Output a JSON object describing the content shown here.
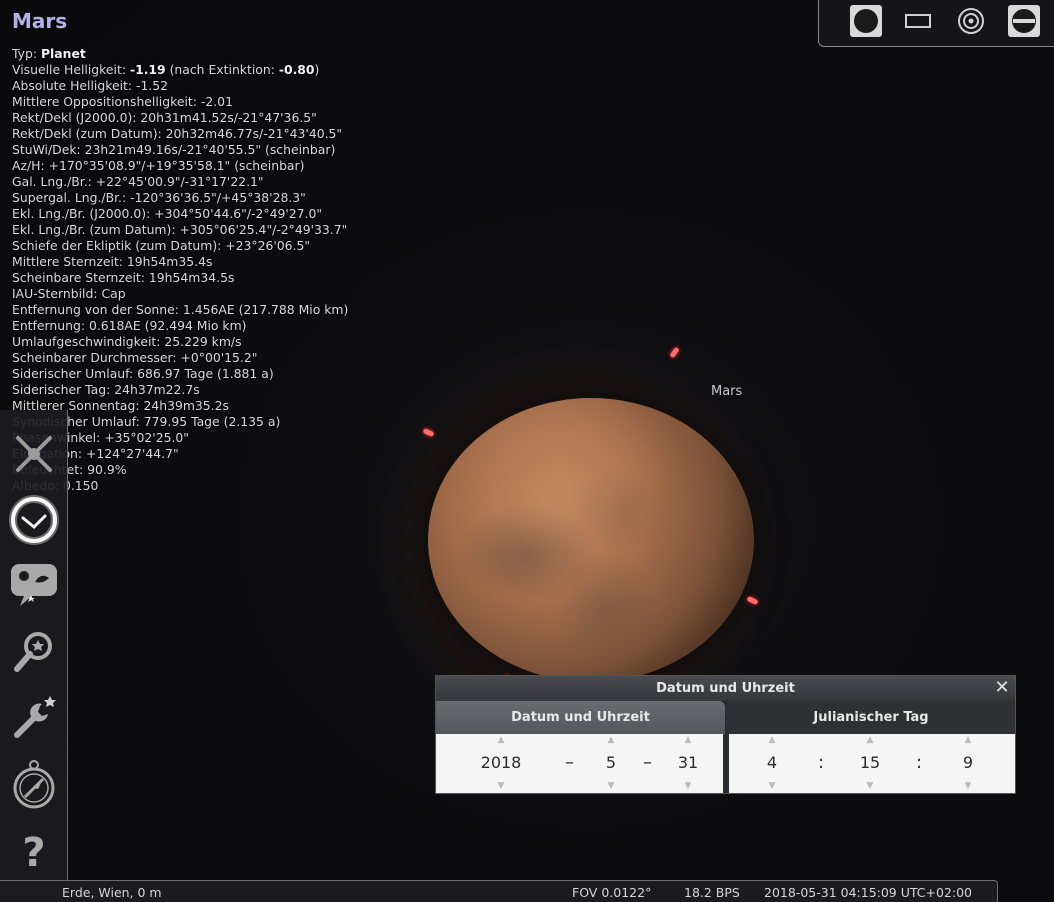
{
  "object": {
    "title": "Mars",
    "info": [
      {
        "label": "Typ: ",
        "bold": "Planet",
        "rest": ""
      },
      {
        "label": "Visuelle Helligkeit: ",
        "bold": "-1.19",
        "rest": " (nach Extinktion: ",
        "bold2": "-0.80",
        "rest2": ")"
      },
      {
        "label": "Absolute Helligkeit: -1.52"
      },
      {
        "label": "Mittlere Oppositionshelligkeit: -2.01"
      },
      {
        "label": "Rekt/Dekl (J2000.0): 20h31m41.52s/-21°47'36.5\""
      },
      {
        "label": "Rekt/Dekl (zum Datum): 20h32m46.77s/-21°43'40.5\""
      },
      {
        "label": "StuWi/Dek: 23h21m49.16s/-21°40'55.5\" (scheinbar)"
      },
      {
        "label": "Az/H: +170°35'08.9\"/+19°35'58.1\" (scheinbar)"
      },
      {
        "label": "Gal. Lng./Br.: +22°45'00.9\"/-31°17'22.1\""
      },
      {
        "label": "Supergal. Lng./Br.: -120°36'36.5\"/+45°38'28.3\""
      },
      {
        "label": "Ekl. Lng./Br. (J2000.0): +304°50'44.6\"/-2°49'27.0\""
      },
      {
        "label": "Ekl. Lng./Br. (zum Datum): +305°06'25.4\"/-2°49'33.7\""
      },
      {
        "label": "Schiefe der Ekliptik (zum Datum): +23°26'06.5\""
      },
      {
        "label": "Mittlere Sternzeit: 19h54m35.4s"
      },
      {
        "label": "Scheinbare Sternzeit: 19h54m34.5s"
      },
      {
        "label": "IAU-Sternbild: Cap"
      },
      {
        "label": "Entfernung von der Sonne: 1.456AE (217.788 Mio km)"
      },
      {
        "label": "Entfernung: 0.618AE (92.494 Mio km)"
      },
      {
        "label": "Umlaufgeschwindigkeit: 25.229 km/s"
      },
      {
        "label": "Scheinbarer Durchmesser: +0°00'15.2\""
      },
      {
        "label": "Siderischer Umlauf: 686.97 Tage (1.881 a)"
      },
      {
        "label": "Siderischer Tag: 24h37m22.7s"
      },
      {
        "label": "Mittlerer Sonnentag: 24h39m35.2s"
      },
      {
        "label": "Synodischer Umlauf: 779.95 Tage (2.135 a)"
      },
      {
        "label": "Phasenwinkel: +35°02'25.0\""
      },
      {
        "label": "Elongation: +124°27'44.7\""
      },
      {
        "label": "Beleuchtet: 90.9%"
      },
      {
        "label": "Albedo: 0.150"
      }
    ]
  },
  "sky": {
    "planet_label": "Mars"
  },
  "top_toolbar": {
    "icons": [
      "planet-disk-icon",
      "window-rect-icon",
      "target-icon",
      "toggle-icon"
    ]
  },
  "left_toolbar": {
    "icons": [
      "location-icon",
      "clock-icon",
      "sky-settings-icon",
      "search-icon",
      "config-icon",
      "compass-icon",
      "help-icon"
    ]
  },
  "status_bar": {
    "location": "Erde, Wien, 0 m",
    "fov": "FOV 0.0122°",
    "fps": "18.2 BPS",
    "datetime": "2018-05-31 04:15:09 UTC+02:00"
  },
  "datetime_dialog": {
    "title": "Datum und Uhrzeit",
    "tabs": [
      "Datum und Uhrzeit",
      "Julianischer Tag"
    ],
    "year": "2018",
    "month": "5",
    "day": "31",
    "hour": "4",
    "minute": "15",
    "second": "9",
    "date_sep": "–",
    "time_sep": ":",
    "close": "✕"
  },
  "colors": {
    "title": "#b7b0e8",
    "marker": "#ff6b6b",
    "mars": "#a56f4c"
  }
}
